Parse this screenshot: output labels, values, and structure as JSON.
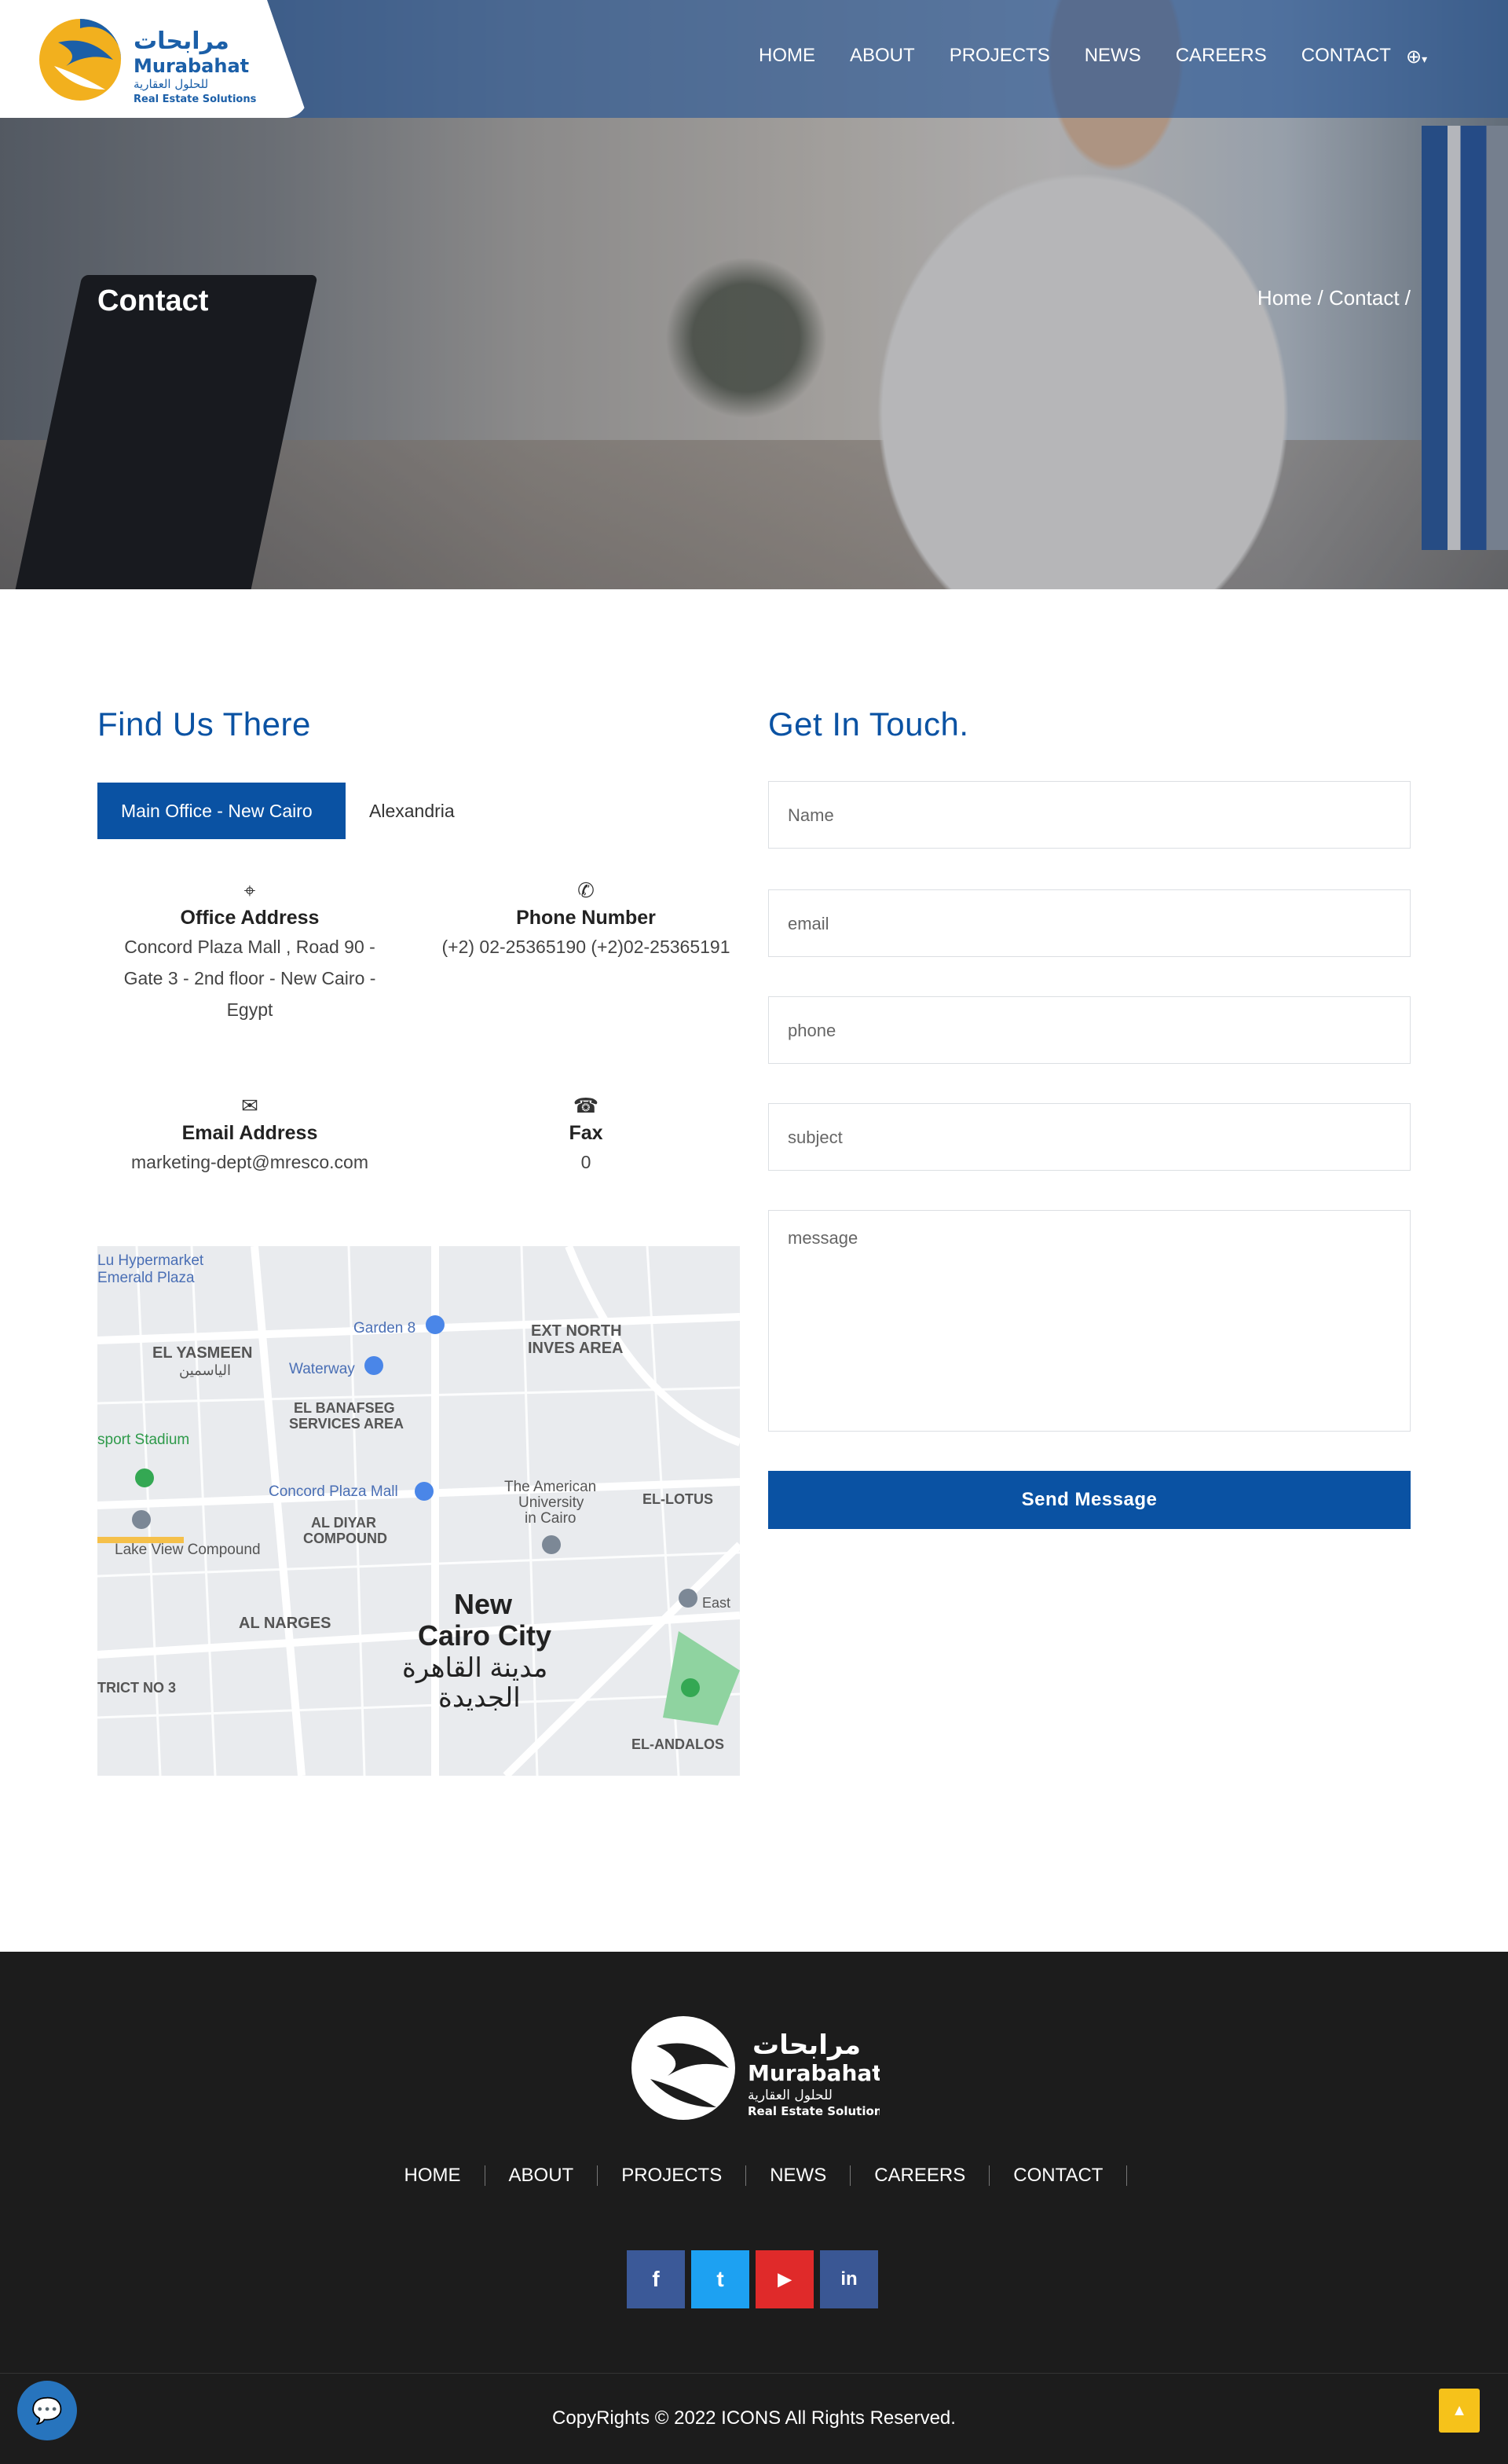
{
  "brand": {
    "arabic": "مرابحات",
    "name": "Murabahat",
    "arabic_sub": "للحلول العقارية",
    "tagline": "Real Estate Solutions"
  },
  "nav": [
    "HOME",
    "ABOUT",
    "PROJECTS",
    "NEWS",
    "CAREERS",
    "CONTACT"
  ],
  "language_icon": "globe-icon",
  "hero": {
    "title": "Contact",
    "breadcrumb": "Home / Contact /"
  },
  "find_us": {
    "title": "Find Us There",
    "tabs": [
      "Main Office - New Cairo",
      "Alexandria"
    ],
    "office": {
      "label": "Office Address",
      "value": "Concord Plaza Mall , Road 90 - Gate 3 - 2nd floor - New Cairo - Egypt"
    },
    "phone": {
      "label": "Phone Number",
      "value": "(+2) 02-25365190 (+2)02-25365191"
    },
    "email": {
      "label": "Email Address",
      "value": "marketing-dept@mresco.com"
    },
    "fax": {
      "label": "Fax",
      "value": "0"
    }
  },
  "map": {
    "labels": [
      "Lu Hypermarket",
      "Emerald Plaza",
      "Garden 8",
      "EL YASMEEN",
      "الياسمين",
      "Waterway",
      "EXT NORTH",
      "INVES AREA",
      "EL BANAFSEG",
      "SERVICES AREA",
      "sport Stadium",
      "Concord Plaza Mall",
      "The American",
      "University",
      "in Cairo",
      "AL DIYAR",
      "COMPOUND",
      "EL-LOTUS",
      "Lake View Compound",
      "AL NARGES",
      "New",
      "Cairo City",
      "مدينة القاهرة",
      "الجديدة",
      "TRICT NO 3",
      "EL-ANDALOS",
      "East"
    ]
  },
  "contact_form": {
    "title": "Get In Touch.",
    "name_placeholder": "Name",
    "email_placeholder": "email",
    "phone_placeholder": "phone",
    "subject_placeholder": "subject",
    "message_placeholder": "message",
    "submit_label": "Send Message"
  },
  "footer": {
    "nav": [
      "HOME",
      "ABOUT",
      "PROJECTS",
      "NEWS",
      "CAREERS",
      "CONTACT"
    ],
    "social": [
      {
        "icon": "facebook-icon",
        "glyph": "f",
        "color": "#3b5998"
      },
      {
        "icon": "twitter-icon",
        "glyph": "t",
        "color": "#1da1f2"
      },
      {
        "icon": "youtube-icon",
        "glyph": "▶",
        "color": "#e02a2a"
      },
      {
        "icon": "linkedin-icon",
        "glyph": "in",
        "color": "#3a5794"
      }
    ],
    "copyright": "CopyRights © 2022 ICONS All Rights Reserved."
  },
  "colors": {
    "primary": "#0a52a3",
    "footer_bg": "#1c1c1c",
    "scroll_top": "#f6c21a",
    "chat": "#2774bd"
  }
}
